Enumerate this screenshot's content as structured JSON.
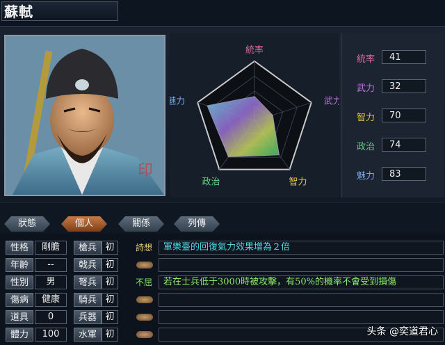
{
  "title": "蘇軾",
  "radar": {
    "labels": [
      "統率",
      "武力",
      "智力",
      "政治",
      "魅力"
    ],
    "colors": [
      "#e06a9a",
      "#b87bd8",
      "#e8c04a",
      "#5fd080",
      "#79a8e8"
    ],
    "values": [
      41,
      32,
      70,
      74,
      83
    ],
    "max": 100
  },
  "stats": [
    {
      "label": "統率",
      "value": "41",
      "color": "#e06a9a"
    },
    {
      "label": "武力",
      "value": "32",
      "color": "#b87bd8"
    },
    {
      "label": "智力",
      "value": "70",
      "color": "#e8c04a"
    },
    {
      "label": "政治",
      "value": "74",
      "color": "#5fd080"
    },
    {
      "label": "魅力",
      "value": "83",
      "color": "#79a8e8"
    }
  ],
  "tabs": [
    "狀態",
    "個人",
    "關係",
    "列傳"
  ],
  "active_tab": "個人",
  "personal": [
    {
      "label": "性格",
      "value": "剛膽"
    },
    {
      "label": "年齡",
      "value": "--"
    },
    {
      "label": "性別",
      "value": "男"
    },
    {
      "label": "傷病",
      "value": "健康"
    },
    {
      "label": "道具",
      "value": "0"
    },
    {
      "label": "體力",
      "value": "100"
    }
  ],
  "troops": [
    {
      "label": "槍兵",
      "value": "初"
    },
    {
      "label": "戟兵",
      "value": "初"
    },
    {
      "label": "弩兵",
      "value": "初"
    },
    {
      "label": "騎兵",
      "value": "初"
    },
    {
      "label": "兵器",
      "value": "初"
    },
    {
      "label": "水軍",
      "value": "初"
    }
  ],
  "skills": [
    {
      "name": "詩想",
      "desc": "軍樂臺的回復氣力效果增為２倍",
      "desc_color": "#4fd8e0",
      "name_color": "#e8d070"
    },
    {
      "name": "",
      "desc": "",
      "desc_color": "#ffffff",
      "name_color": "#ffffff"
    },
    {
      "name": "不屈",
      "desc": "若在士兵低于3000時被攻擊，有50%的機率不會受到損傷",
      "desc_color": "#8ee86a",
      "name_color": "#8ee86a"
    },
    {
      "name": "",
      "desc": "",
      "desc_color": "#ffffff",
      "name_color": "#ffffff"
    },
    {
      "name": "",
      "desc": "",
      "desc_color": "#ffffff",
      "name_color": "#ffffff"
    },
    {
      "name": "",
      "desc": "",
      "desc_color": "#ffffff",
      "name_color": "#ffffff"
    }
  ],
  "watermark": "头条 @奕道君心"
}
